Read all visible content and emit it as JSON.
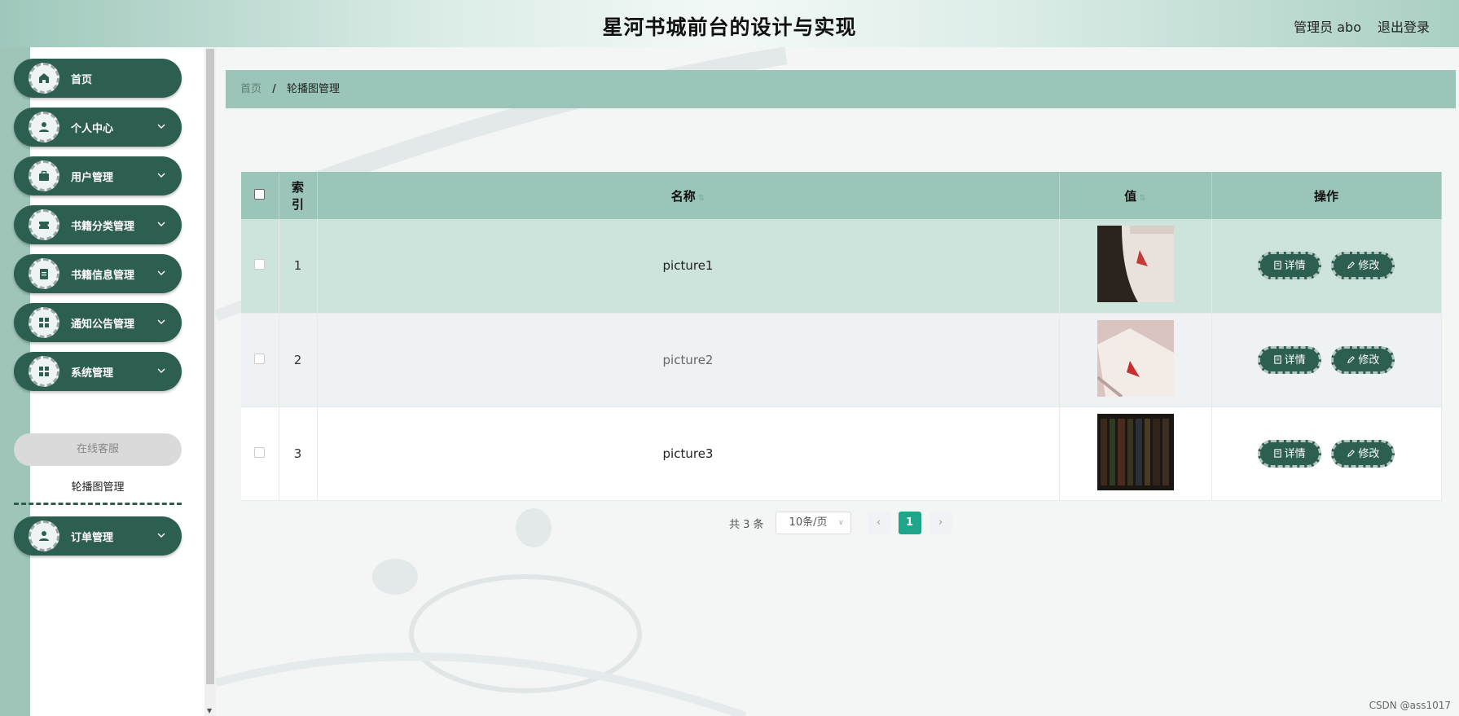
{
  "header": {
    "title": "星河书城前台的设计与实现",
    "user": "管理员 abo",
    "logout": "退出登录"
  },
  "sidebar": {
    "items": [
      {
        "label": "首页",
        "icon": "home-icon",
        "has_chevron": false
      },
      {
        "label": "个人中心",
        "icon": "user-icon",
        "has_chevron": true
      },
      {
        "label": "用户管理",
        "icon": "briefcase-icon",
        "has_chevron": true
      },
      {
        "label": "书籍分类管理",
        "icon": "ticket-icon",
        "has_chevron": true
      },
      {
        "label": "书籍信息管理",
        "icon": "clipboard-icon",
        "has_chevron": true
      },
      {
        "label": "通知公告管理",
        "icon": "grid-icon",
        "has_chevron": true
      },
      {
        "label": "系统管理",
        "icon": "grid-icon",
        "has_chevron": true
      },
      {
        "label": "订单管理",
        "icon": "user-icon",
        "has_chevron": true
      }
    ],
    "sub_items": [
      {
        "label": "在线客服"
      },
      {
        "label": "轮播图管理"
      }
    ]
  },
  "breadcrumb": {
    "home": "首页",
    "separator": "/",
    "current": "轮播图管理"
  },
  "table": {
    "columns": [
      "",
      "索引",
      "名称",
      "值",
      "操作"
    ],
    "index_header": [
      "索",
      "引"
    ],
    "rows": [
      {
        "index": "1",
        "name": "picture1"
      },
      {
        "index": "2",
        "name": "picture2"
      },
      {
        "index": "3",
        "name": "picture3"
      }
    ],
    "actions": {
      "detail": "详情",
      "edit": "修改"
    }
  },
  "pagination": {
    "total": "共 3 条",
    "page_size": "10条/页",
    "current_page": "1",
    "prev": "‹",
    "next": "›"
  },
  "watermark": "CSDN @ass1017",
  "colors": {
    "accent": "#2c5f50",
    "header_bg": "#9ac5b8",
    "page_active": "#1fa68a"
  }
}
